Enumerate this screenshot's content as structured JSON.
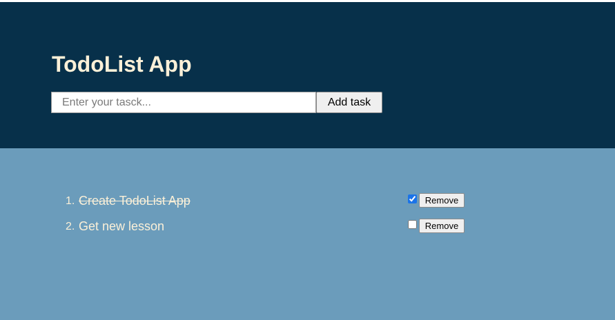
{
  "header": {
    "title": "TodoList App",
    "input_placeholder": "Enter your tasck...",
    "input_value": "",
    "add_button_label": "Add task"
  },
  "tasks": [
    {
      "index": "1.",
      "text": "Create TodoList App",
      "completed": true,
      "remove_label": "Remove"
    },
    {
      "index": "2.",
      "text": "Get new lesson",
      "completed": false,
      "remove_label": "Remove"
    }
  ],
  "colors": {
    "header_background": "#07304a",
    "content_background": "#6b9cbb",
    "text_cream": "#fbf0d8"
  }
}
